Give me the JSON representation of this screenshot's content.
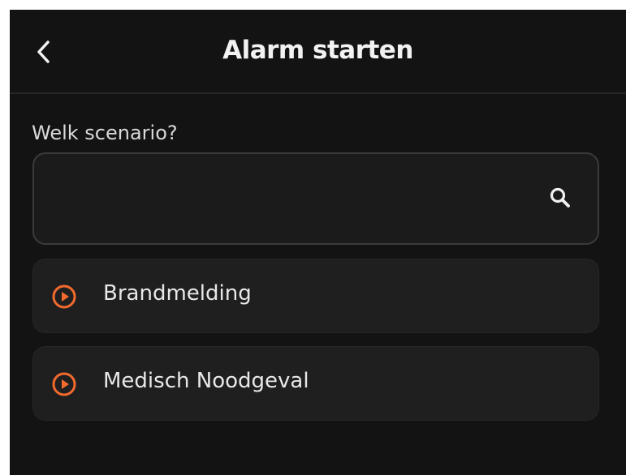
{
  "header": {
    "title": "Alarm starten",
    "back_icon": "chevron-left-icon"
  },
  "form": {
    "question": "Welk scenario?",
    "search": {
      "value": "",
      "placeholder": "",
      "icon": "search-icon"
    }
  },
  "scenarios": [
    {
      "label": "Brandmelding",
      "icon": "play-circle-icon"
    },
    {
      "label": "Medisch Noodgeval",
      "icon": "play-circle-icon"
    }
  ],
  "colors": {
    "background": "#131313",
    "card": "#1f1f1f",
    "accent": "#f26a2e",
    "text": "#e8e8e8"
  }
}
